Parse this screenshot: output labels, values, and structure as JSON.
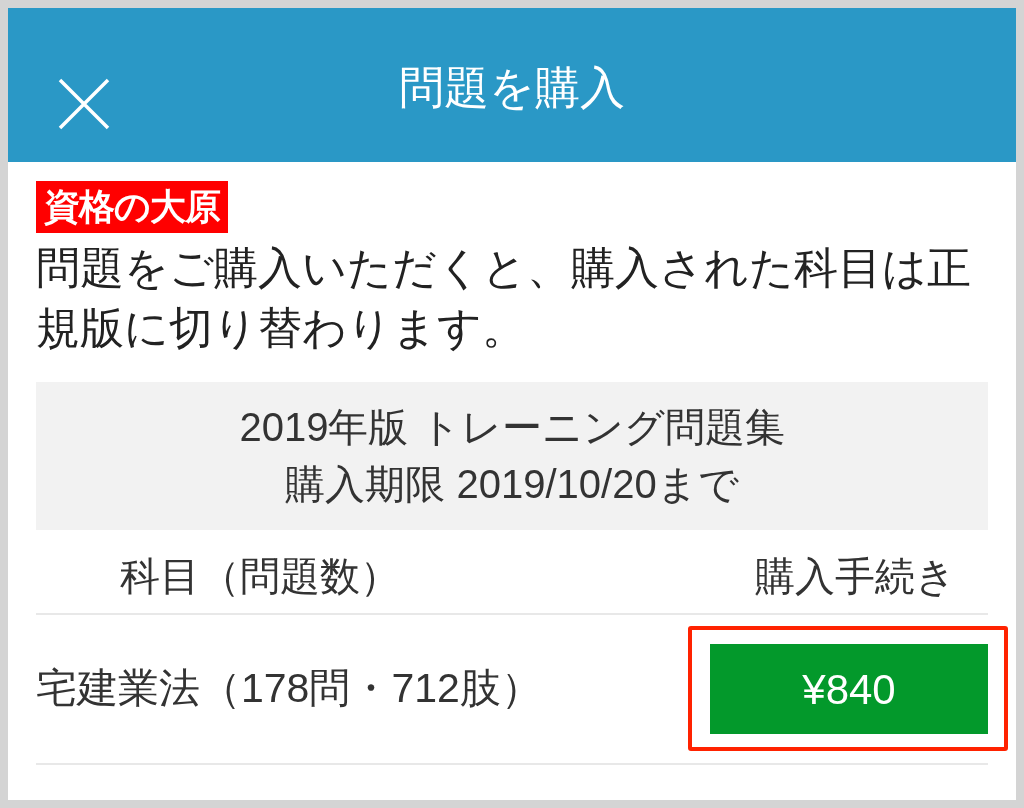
{
  "header": {
    "title": "問題を購入"
  },
  "logo": {
    "text": "資格の大原"
  },
  "notice": "問題をご購入いただくと、購入された科目は正規版に切り替わります。",
  "product": {
    "title": "2019年版 トレーニング問題集",
    "deadline": "購入期限 2019/10/20まで"
  },
  "table": {
    "columns": [
      "科目（問題数）",
      "購入手続き"
    ],
    "rows": [
      {
        "subject": "宅建業法（178問・712肢）",
        "price": "¥840",
        "highlighted": true
      }
    ]
  }
}
